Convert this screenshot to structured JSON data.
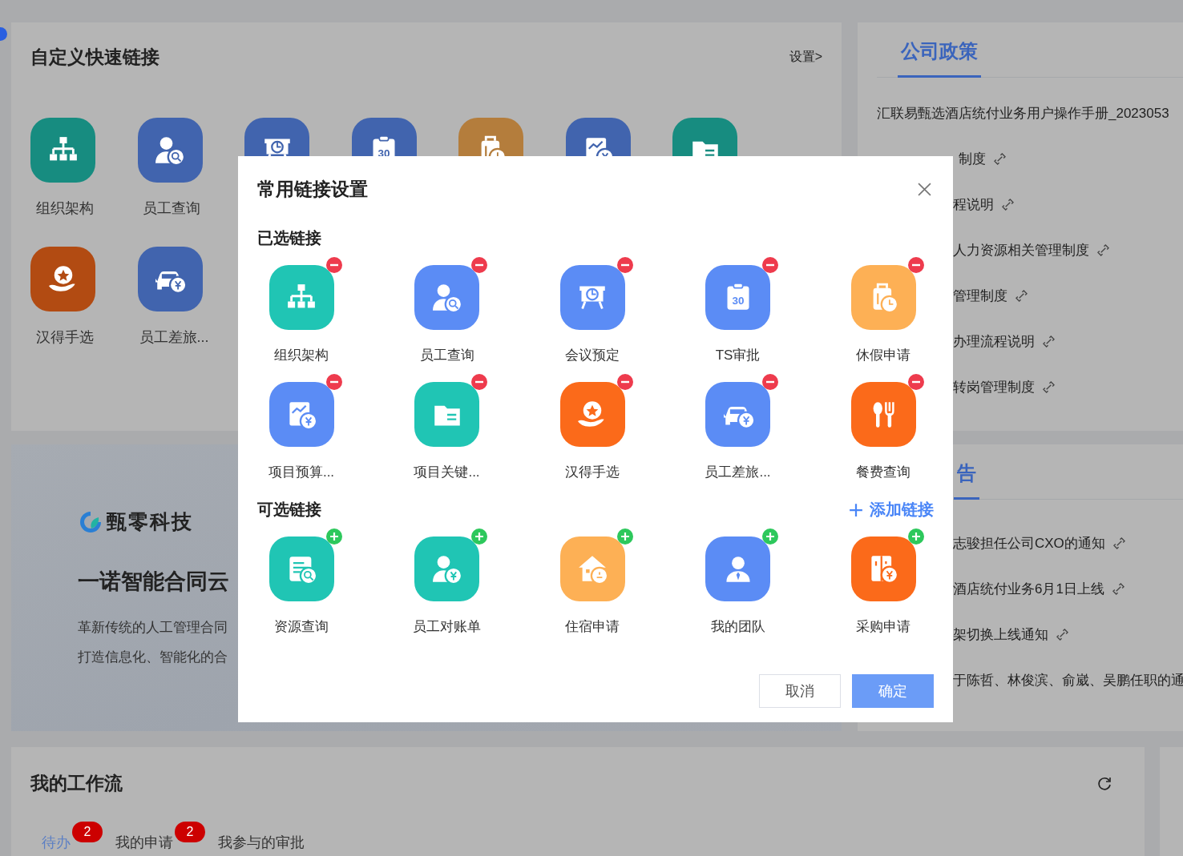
{
  "quick_links": {
    "title": "自定义快速链接",
    "settings_link": "设置>",
    "items": [
      {
        "label": "组织架构",
        "kind": "org",
        "color": "#178c80"
      },
      {
        "label": "员工查询",
        "kind": "user-search",
        "color": "#4164ae"
      },
      {
        "kind": "meeting",
        "color": "#4164ae"
      },
      {
        "kind": "calendar",
        "color": "#4164ae",
        "icon_text": "30"
      },
      {
        "kind": "luggage",
        "color": "#b47d3c"
      },
      {
        "kind": "chart-money",
        "color": "#4164ae"
      },
      {
        "kind": "folder",
        "color": "#178c80"
      },
      {
        "label": "汉得手选",
        "kind": "star-hand",
        "color": "#b24b12"
      },
      {
        "label": "员工差旅...",
        "kind": "car-money",
        "color": "#4164ae"
      }
    ]
  },
  "policy": {
    "tab": {
      "label": "公司政策",
      "selected": true
    },
    "items": [
      {
        "text": "汇联易甄选酒店统付业务用户操作手册_2023053"
      },
      {
        "text": "制度",
        "link": true
      },
      {
        "text": "程说明",
        "link": true
      },
      {
        "text": "人力资源相关管理制度",
        "link": true
      },
      {
        "text": "管理制度",
        "link": true
      },
      {
        "text": "办理流程说明",
        "link": true
      },
      {
        "text": "转岗管理制度",
        "link": true
      }
    ]
  },
  "banner": {
    "logo_text": "甄零科技",
    "headline": "一诺智能合同云",
    "lines": [
      "革新传统的人工管理合同",
      "打造信息化、智能化的合"
    ]
  },
  "notice": {
    "tab": {
      "label": "告",
      "selected": true
    },
    "items": [
      {
        "text": "志骏担任公司CXO的通知",
        "link": true
      },
      {
        "text": "酒店统付业务6月1日上线",
        "link": true
      },
      {
        "text": "架切换上线通知",
        "link": true
      },
      {
        "text": "于陈哲、林俊滨、俞崴、吴鹏任职的通"
      }
    ]
  },
  "workflow": {
    "title": "我的工作流",
    "tabs": [
      {
        "label": "待办",
        "badge": "2",
        "selected": true
      },
      {
        "label": "我的申请",
        "badge": "2",
        "selected": false
      },
      {
        "label": "我参与的审批",
        "selected": false
      }
    ]
  },
  "dialog": {
    "title": "常用链接设置",
    "selected_title": "已选链接",
    "optional_title": "可选链接",
    "add_link": "添加链接",
    "selected_links": [
      {
        "label": "组织架构",
        "kind": "org",
        "color": "#20c5b4"
      },
      {
        "label": "员工查询",
        "kind": "user-search",
        "color": "#5b8cf5"
      },
      {
        "label": "会议预定",
        "kind": "meeting",
        "color": "#5b8cf5"
      },
      {
        "label": "TS审批",
        "kind": "calendar",
        "color": "#5b8cf5",
        "icon_text": "30"
      },
      {
        "label": "休假申请",
        "kind": "luggage",
        "color": "#fdb055"
      },
      {
        "label": "项目预算...",
        "kind": "chart-money",
        "color": "#5b8cf5"
      },
      {
        "label": "项目关键...",
        "kind": "folder",
        "color": "#20c5b4"
      },
      {
        "label": "汉得手选",
        "kind": "star-hand",
        "color": "#fb6a1a"
      },
      {
        "label": "员工差旅...",
        "kind": "car-money",
        "color": "#5b8cf5"
      },
      {
        "label": "餐费查询",
        "kind": "cutlery",
        "color": "#fb6a1a"
      }
    ],
    "optional_links": [
      {
        "label": "资源查询",
        "kind": "doc-search",
        "color": "#20c5b4"
      },
      {
        "label": "员工对账单",
        "kind": "user-money",
        "color": "#20c5b4"
      },
      {
        "label": "住宿申请",
        "kind": "house",
        "color": "#fdb055"
      },
      {
        "label": "我的团队",
        "kind": "user-tie",
        "color": "#5b8cf5"
      },
      {
        "label": "采购申请",
        "kind": "fridge-money",
        "color": "#fb6a1a"
      }
    ],
    "buttons": [
      {
        "label": "取消",
        "kind": "secondary"
      },
      {
        "label": "确定",
        "kind": "primary"
      }
    ]
  }
}
